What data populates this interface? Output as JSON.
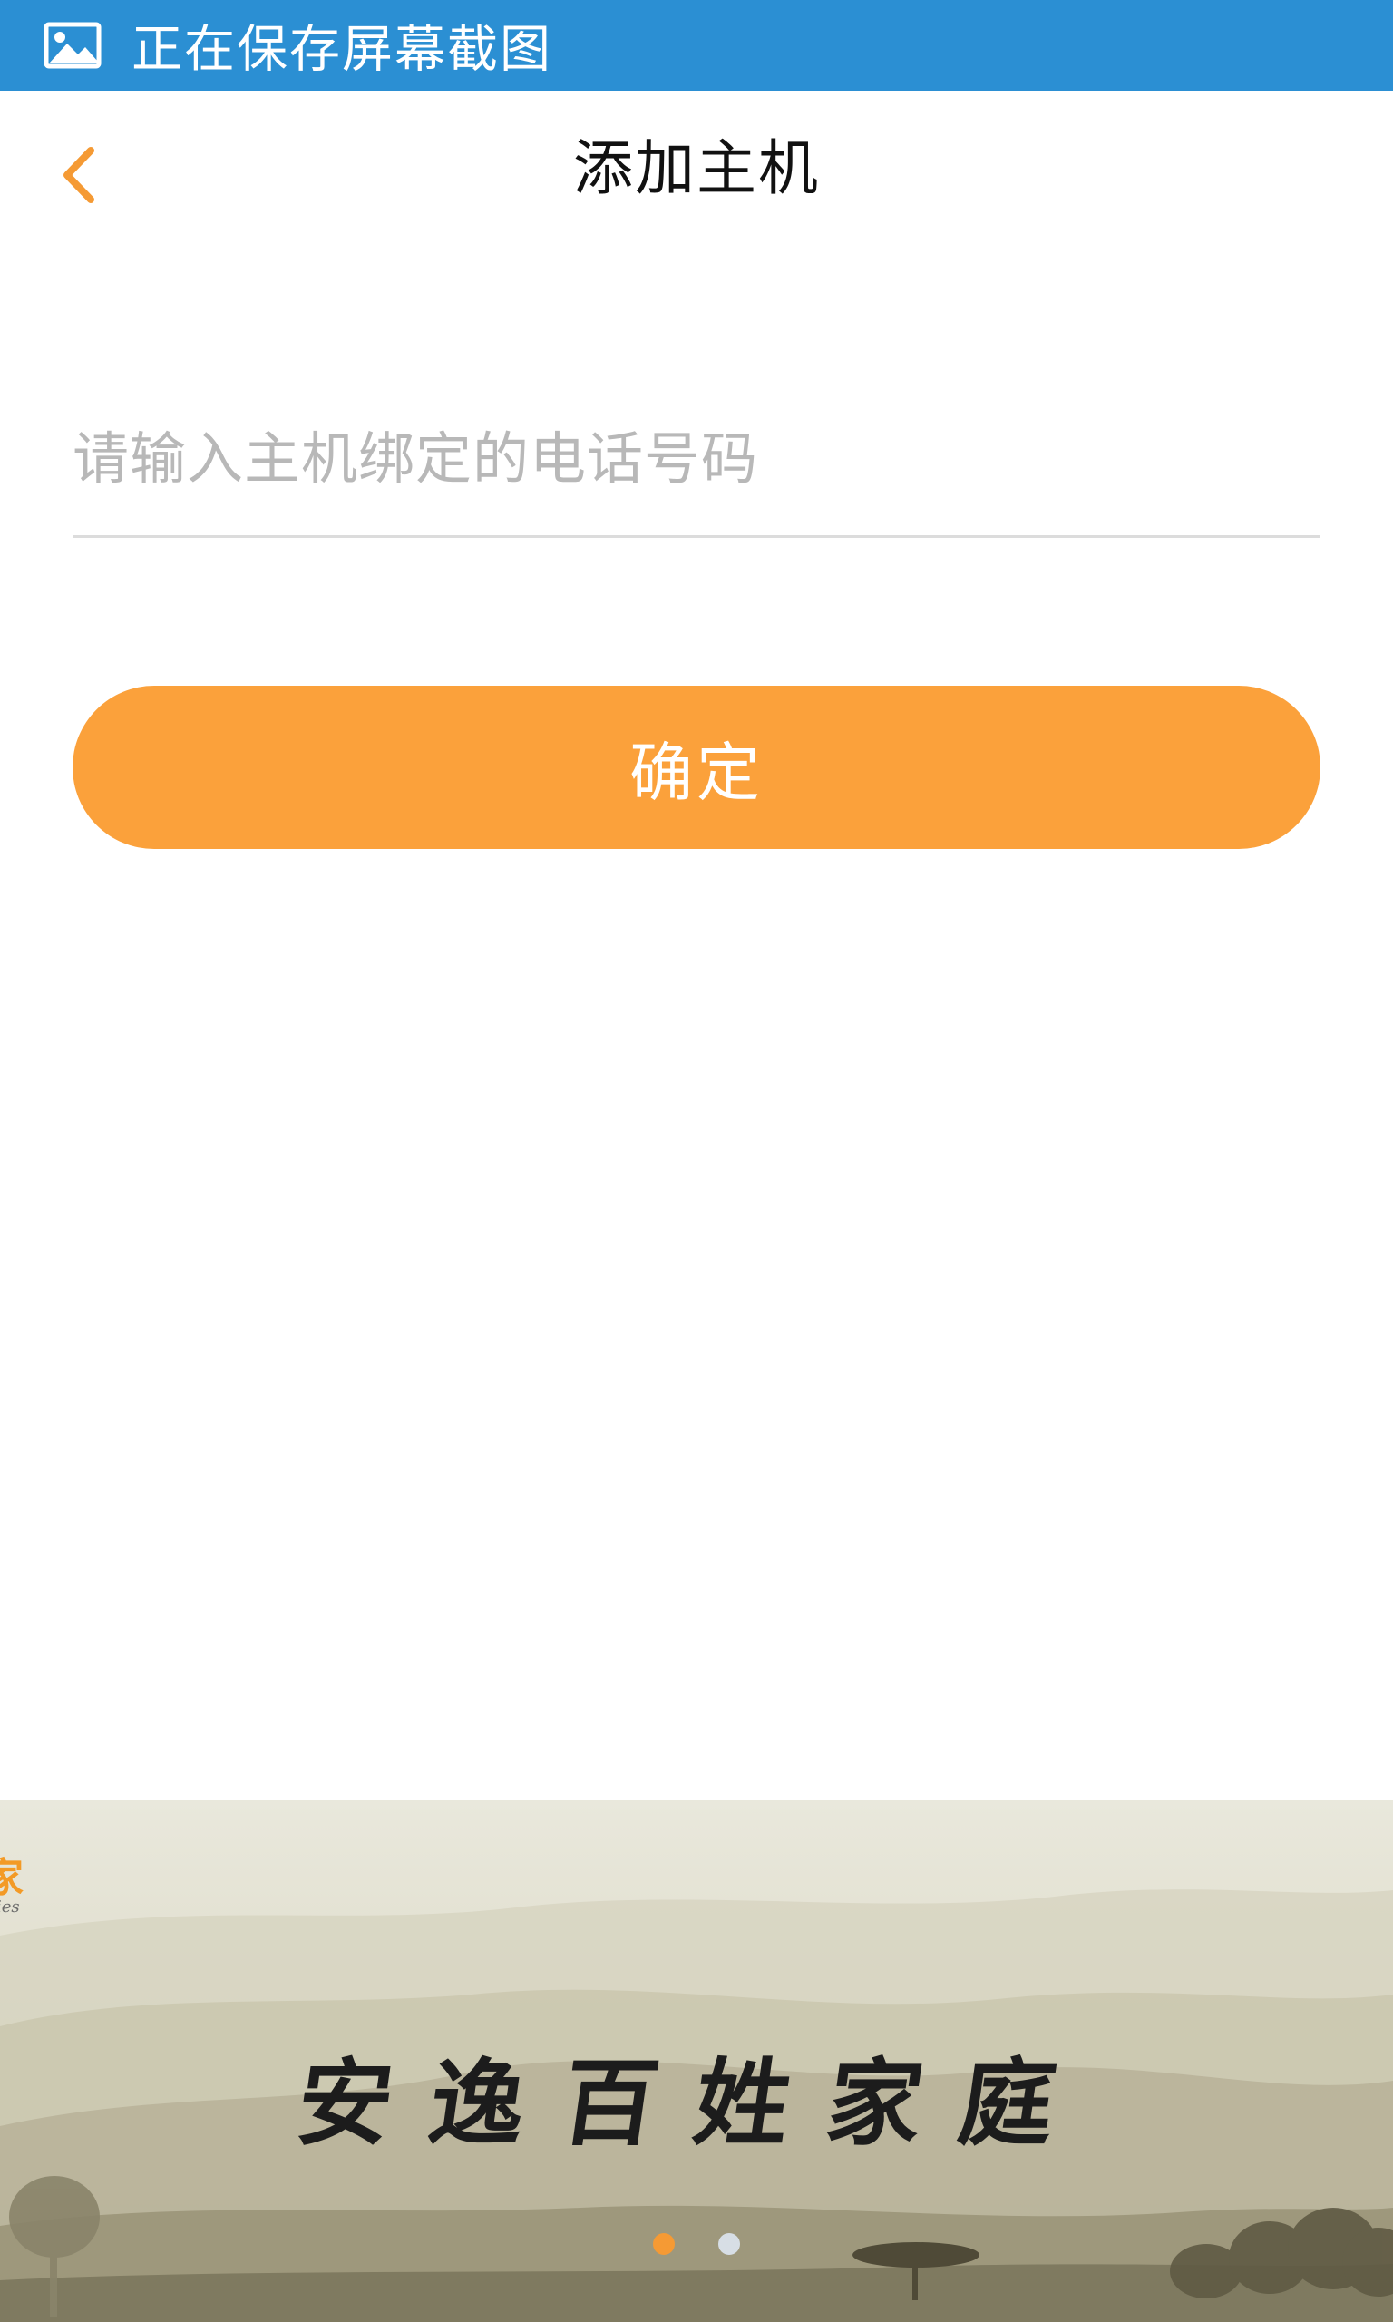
{
  "status_bar": {
    "icon": "image-icon",
    "text": "正在保存屏幕截图",
    "background_color": "#2b8fd3"
  },
  "nav": {
    "back_icon": "chevron-left-icon",
    "title": "添加主机",
    "accent_color": "#f59a34"
  },
  "form": {
    "phone_placeholder": "请输入主机绑定的电话号码",
    "phone_value": "",
    "confirm_label": "确定",
    "button_color": "#fba13b"
  },
  "banner": {
    "brand_text": "家",
    "brand_subtext": "ies",
    "slogan": "安逸百姓家庭",
    "pages": 2,
    "active_page": 1
  }
}
